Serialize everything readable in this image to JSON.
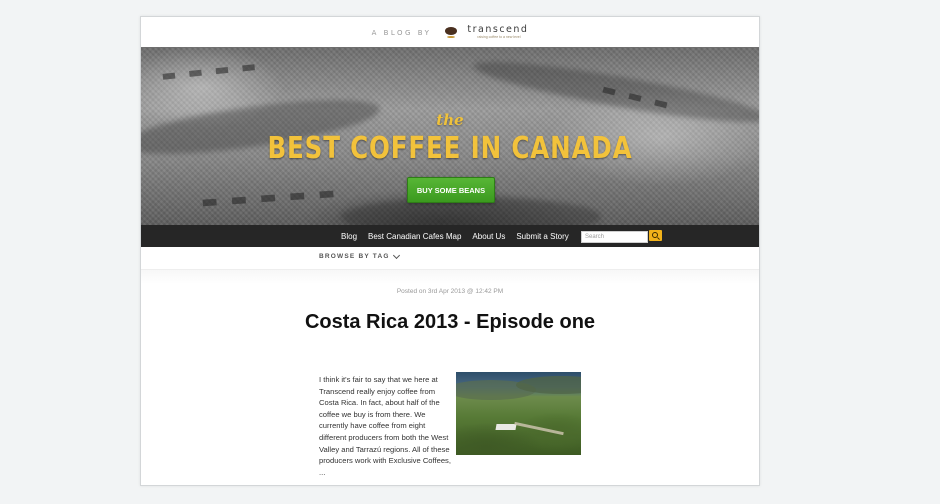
{
  "header": {
    "byline": "A BLOG BY",
    "brand_name": "transcend",
    "brand_tagline": "raising coffee to a new level"
  },
  "hero": {
    "pre_title": "the",
    "title": "BEST COFFEE IN CANADA",
    "cta_label": "BUY SOME BEANS",
    "accent_color": "#f2c23b",
    "cta_color": "#4aa82a"
  },
  "nav": {
    "items": [
      {
        "label": "Blog"
      },
      {
        "label": "Best Canadian Cafes Map"
      },
      {
        "label": "About Us"
      },
      {
        "label": "Submit a Story"
      }
    ],
    "search_placeholder": "Search"
  },
  "browse": {
    "label": "BROWSE BY TAG"
  },
  "post": {
    "posted": "Posted on 3rd Apr 2013 @ 12:42 PM",
    "title": "Costa Rica 2013 - Episode one",
    "excerpt": "I think it's fair to say that we here at Transcend really enjoy coffee from Costa Rica. In fact, about half of the coffee we buy is from there. We currently have coffee from eight different producers from both the West Valley and Tarrazú regions. All of these producers work with Exclusive Coffees, ..."
  }
}
